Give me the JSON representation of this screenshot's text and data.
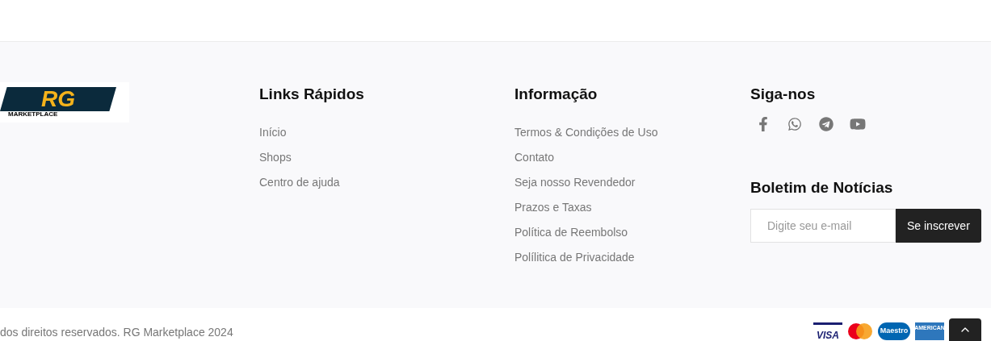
{
  "logo": {
    "mark": "RG",
    "caption": "MARKETPLACE"
  },
  "quick_links": {
    "title": "Links Rápidos",
    "items": [
      "Início",
      "Shops",
      "Centro de ajuda"
    ]
  },
  "information": {
    "title": "Informação",
    "items": [
      "Termos & Condições de Uso",
      "Contato",
      "Seja nosso Revendedor",
      "Prazos e Taxas",
      "Política de Reembolso",
      "Polílitica de Privacidade"
    ]
  },
  "social": {
    "title": "Siga-nos",
    "icons": [
      {
        "kind": "facebook"
      },
      {
        "kind": "whatsapp"
      },
      {
        "kind": "telegram"
      },
      {
        "kind": "youtube"
      }
    ]
  },
  "newsletter": {
    "title": "Boletim de Notícias",
    "placeholder": "Digite seu e-mail",
    "button": "Se inscrever"
  },
  "copyright": "dos direitos reservados. RG Marketplace 2024",
  "payment_cards": [
    {
      "kind": "visa",
      "label": "VISA"
    },
    {
      "kind": "mastercard"
    },
    {
      "kind": "maestro",
      "label": "Maestro"
    },
    {
      "kind": "amex",
      "label": "AMERICAN"
    }
  ]
}
